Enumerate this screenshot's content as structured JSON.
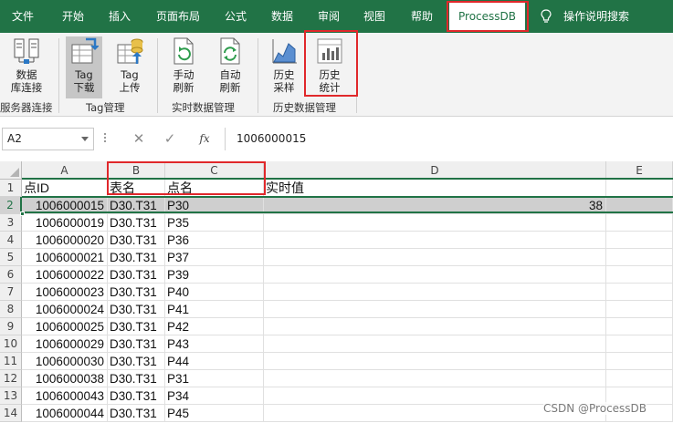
{
  "menu": {
    "tabs": [
      "文件",
      "开始",
      "插入",
      "页面布局",
      "公式",
      "数据",
      "审阅",
      "视图",
      "帮助"
    ],
    "active_tab": "ProcessDB",
    "search_label": "操作说明搜索"
  },
  "ribbon": {
    "buttons": {
      "db_connect": [
        "数据",
        "库连接"
      ],
      "tag_download": [
        "Tag",
        "下载"
      ],
      "tag_upload": [
        "Tag",
        "上传"
      ],
      "manual_refresh": [
        "手动",
        "刷新"
      ],
      "auto_refresh": [
        "自动",
        "刷新"
      ],
      "history_sample": [
        "历史",
        "采样"
      ],
      "history_stats": [
        "历史",
        "统计"
      ]
    },
    "groups": {
      "server_connect": "服务器连接",
      "tag_manage": "Tag管理",
      "realtime_manage": "实时数据管理",
      "history_manage": "历史数据管理"
    }
  },
  "formula_bar": {
    "name_box": "A2",
    "cancel": "✕",
    "enter": "✓",
    "fx": "fx",
    "value": "1006000015"
  },
  "sheet": {
    "columns": [
      "A",
      "B",
      "C",
      "D",
      "E"
    ],
    "header_row": [
      "点ID",
      "表名",
      "点名",
      "实时值"
    ],
    "rows": [
      [
        "1006000015",
        "D30.T31",
        "P30",
        "38"
      ],
      [
        "1006000019",
        "D30.T31",
        "P35",
        ""
      ],
      [
        "1006000020",
        "D30.T31",
        "P36",
        ""
      ],
      [
        "1006000021",
        "D30.T31",
        "P37",
        ""
      ],
      [
        "1006000022",
        "D30.T31",
        "P39",
        ""
      ],
      [
        "1006000023",
        "D30.T31",
        "P40",
        ""
      ],
      [
        "1006000024",
        "D30.T31",
        "P41",
        ""
      ],
      [
        "1006000025",
        "D30.T31",
        "P42",
        ""
      ],
      [
        "1006000029",
        "D30.T31",
        "P43",
        ""
      ],
      [
        "1006000030",
        "D30.T31",
        "P44",
        ""
      ],
      [
        "1006000038",
        "D30.T31",
        "P31",
        ""
      ],
      [
        "1006000043",
        "D30.T31",
        "P34",
        ""
      ],
      [
        "1006000044",
        "D30.T31",
        "P45",
        ""
      ]
    ],
    "row_numbers": [
      "1",
      "2",
      "3",
      "4",
      "5",
      "6",
      "7",
      "8",
      "9",
      "10",
      "11",
      "12",
      "13",
      "14"
    ]
  },
  "watermark": "CSDN @ProcessDB",
  "colors": {
    "accent": "#217346",
    "annotation": "#e0282b"
  }
}
